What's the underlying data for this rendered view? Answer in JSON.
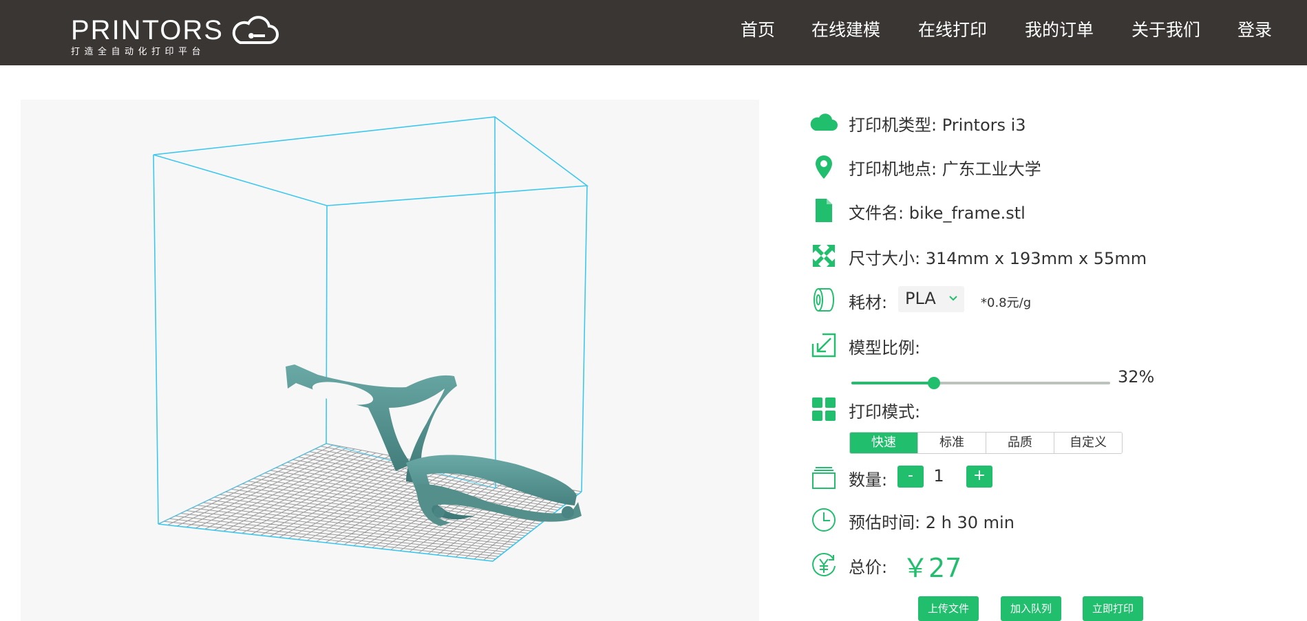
{
  "header": {
    "logo_text": "PRINTORS",
    "logo_tagline": "打造全自动化打印平台",
    "nav": [
      "首页",
      "在线建模",
      "在线打印",
      "我的订单",
      "关于我们",
      "登录"
    ]
  },
  "info": {
    "printer_type_label": "打印机类型:",
    "printer_type_value": "Printors i3",
    "printer_location_label": "打印机地点:",
    "printer_location_value": "广东工业大学",
    "file_name_label": "文件名:",
    "file_name_value": "bike_frame.stl",
    "dimensions_label": "尺寸大小:",
    "dimensions_value": "314mm x 193mm x 55mm",
    "material_label": "耗材:",
    "material_value": "PLA",
    "material_price": "*0.8元/g",
    "scale_label": "模型比例:",
    "scale_value": 32,
    "scale_text": "32%",
    "mode_label": "打印模式:",
    "modes": [
      "快速",
      "标准",
      "品质",
      "自定义"
    ],
    "active_mode": "快速",
    "quantity_label": "数量:",
    "quantity_minus": "-",
    "quantity_value": "1",
    "quantity_plus": "+",
    "time_label": "预估时间:",
    "time_value": "2 h 30 min",
    "total_label": "总价:",
    "total_value": "￥27"
  },
  "actions": {
    "upload": "上传文件",
    "queue": "加入队列",
    "print_now": "立即打印"
  },
  "icons": {
    "printer_type": "cloud-icon",
    "location": "map-pin-icon",
    "file": "file-icon",
    "dimensions": "expand-arrows-icon",
    "material": "filament-spool-icon",
    "scale": "resize-arrow-icon",
    "mode": "grid-icon",
    "quantity": "layers-icon",
    "time": "clock-icon",
    "total": "yen-coin-icon"
  },
  "colors": {
    "accent": "#21be6d",
    "header_bg": "#3a3634",
    "box_lines": "#3cc8ee",
    "model": "#4e8c8a"
  }
}
